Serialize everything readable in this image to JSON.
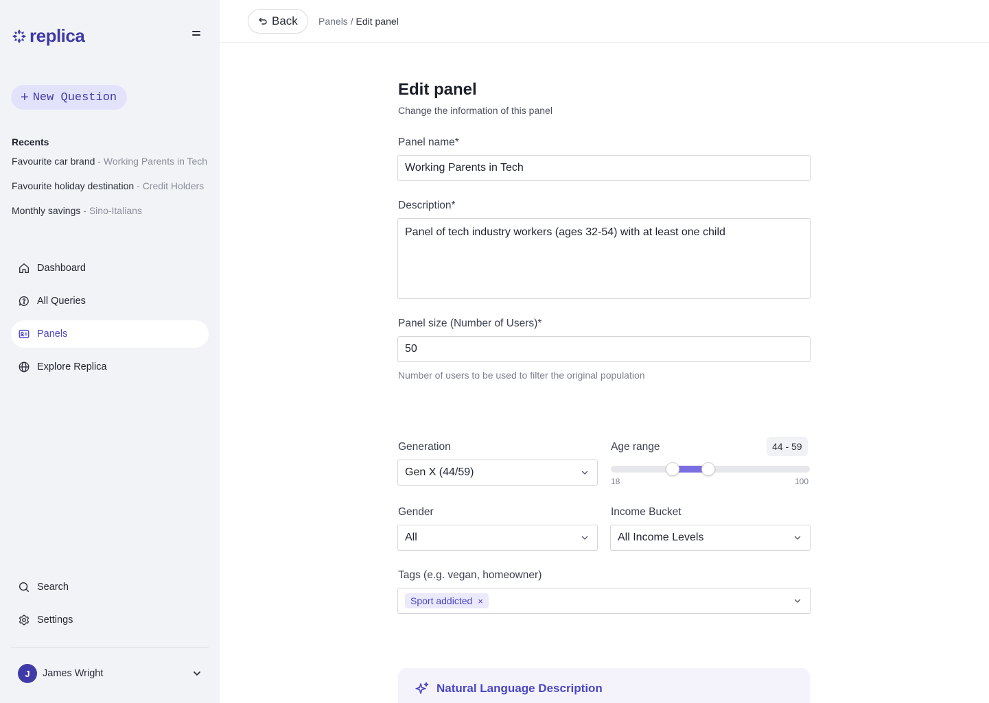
{
  "app": {
    "name": "replica",
    "brand_color": "#3f3aa8",
    "accent": "#7a6ee0"
  },
  "sidebar": {
    "new_question_label": "New Question",
    "recents_title": "Recents",
    "recents": [
      {
        "title": "Favourite car brand",
        "sep": " - ",
        "panel": "Working Parents in Tech"
      },
      {
        "title": "Favourite holiday destination",
        "sep": " -  ",
        "panel": "Credit Holders"
      },
      {
        "title": "Monthly savings",
        "sep": " - ",
        "panel": "Sino-Italians"
      }
    ],
    "nav": [
      {
        "label": "Dashboard",
        "icon": "home-icon",
        "active": false
      },
      {
        "label": "All Queries",
        "icon": "chat-icon",
        "active": false
      },
      {
        "label": "Panels",
        "icon": "id-card-icon",
        "active": true
      },
      {
        "label": "Explore Replica",
        "icon": "globe-icon",
        "active": false
      }
    ],
    "bottom_nav": [
      {
        "label": "Search",
        "icon": "search-icon"
      },
      {
        "label": "Settings",
        "icon": "gear-icon"
      }
    ],
    "user": {
      "initial": "J",
      "name": "James Wright"
    }
  },
  "topbar": {
    "back_label": "Back",
    "breadcrumb_parent": "Panels",
    "breadcrumb_sep": " / ",
    "breadcrumb_current": "Edit panel"
  },
  "form": {
    "title": "Edit panel",
    "subtitle": "Change the information of this panel",
    "panel_name": {
      "label": "Panel name*",
      "value": "Working Parents in Tech"
    },
    "description": {
      "label": "Description*",
      "value": "Panel of tech industry workers (ages 32-54) with at least one child"
    },
    "panel_size": {
      "label": "Panel size (Number of Users)*",
      "value": "50",
      "hint": "Number of users to be used to filter the original population"
    },
    "generation": {
      "label": "Generation",
      "value": "Gen X (44/59)"
    },
    "age_range": {
      "label": "Age range",
      "display": "44 - 59",
      "min": 18,
      "max": 100,
      "low": 44,
      "high": 59,
      "min_label": "18",
      "max_label": "100"
    },
    "gender": {
      "label": "Gender",
      "value": "All"
    },
    "income": {
      "label": "Income Bucket",
      "value": "All Income Levels"
    },
    "tags": {
      "label": "Tags (e.g. vegan, homeowner)",
      "items": [
        "Sport addicted"
      ],
      "remove_glyph": "×"
    },
    "nl_description": {
      "title": "Natural Language Description"
    }
  }
}
